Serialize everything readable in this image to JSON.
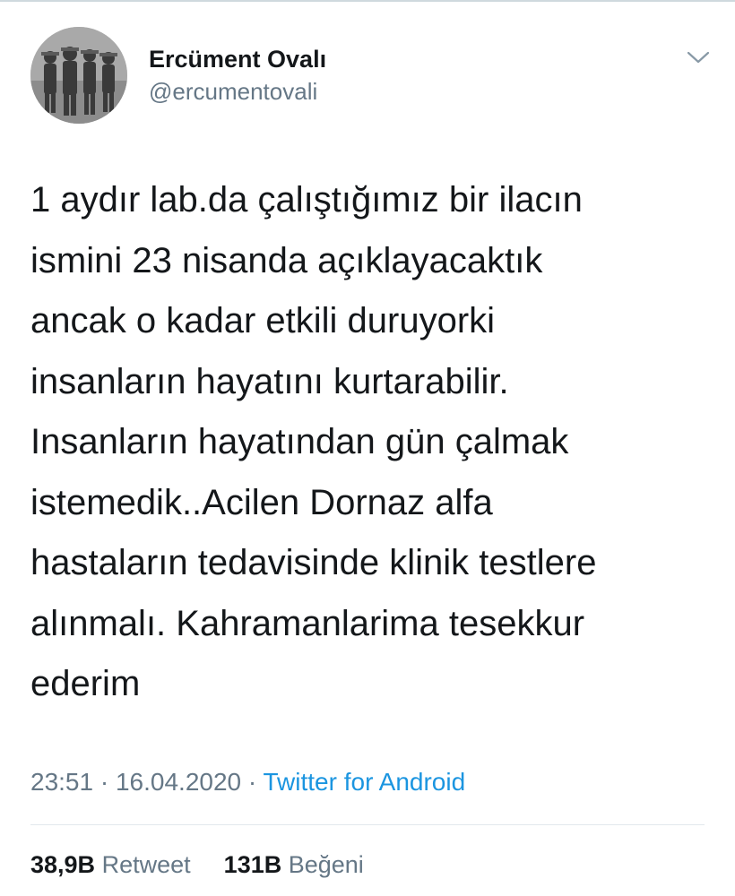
{
  "user": {
    "display_name": "Ercüment Ovalı",
    "handle": "@ercumentovali"
  },
  "icons": {
    "avatar": "profile-photo",
    "menu": "chevron-down-icon"
  },
  "tweet": {
    "lines": [
      "1 aydır lab.da çalıştığımız bir ilacın",
      "ismini 23 nisanda açıklayacaktık",
      "ancak o kadar etkili duruyorki",
      "insanların hayatını kurtarabilir.",
      "Insanların hayatından gün çalmak",
      "istemedik..Acilen Dornaz alfa",
      "hastaların tedavisinde klinik testlere",
      "alınmalı. Kahramanlarima tesekkur",
      "ederim"
    ]
  },
  "meta": {
    "time": "23:51",
    "separator": "·",
    "date": "16.04.2020",
    "source": "Twitter for Android"
  },
  "stats": {
    "retweet_count": "38,9B",
    "retweet_label": "Retweet",
    "like_count": "131B",
    "like_label": "Beğeni"
  },
  "colors": {
    "text": "#14171a",
    "secondary": "#657786",
    "link": "#1b95e0",
    "divider": "#e1e8ed"
  }
}
